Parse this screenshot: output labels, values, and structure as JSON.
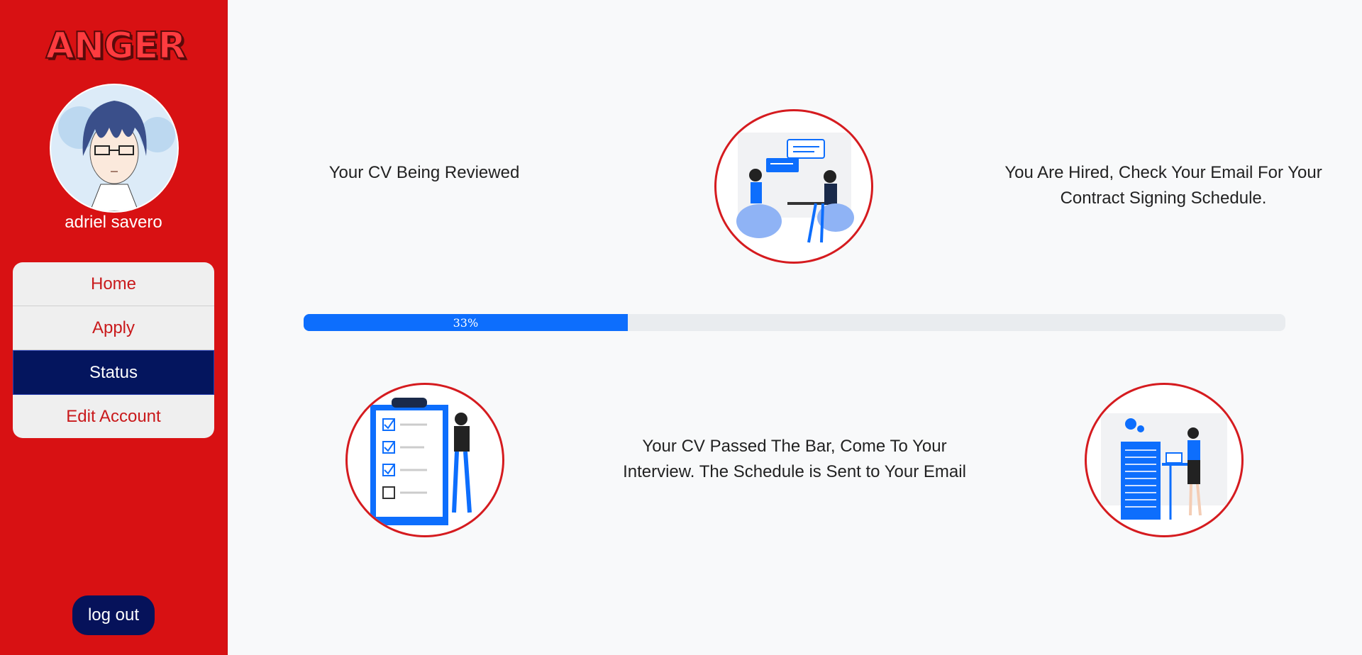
{
  "sidebar": {
    "logo_text": "ANGER",
    "username": "adriel savero",
    "menu": [
      {
        "label": "Home",
        "active": false
      },
      {
        "label": "Apply",
        "active": false
      },
      {
        "label": "Status",
        "active": true
      },
      {
        "label": "Edit Account",
        "active": false
      }
    ],
    "logout_label": "log out"
  },
  "status": {
    "step_reviewed": "Your CV Being Reviewed",
    "step_hired": "You Are Hired, Check Your Email For Your Contract Signing Schedule.",
    "step_interview": "Your CV Passed The Bar, Come To Your Interview. The Schedule is Sent to Your Email",
    "progress_label": "33%",
    "progress_value": 33
  },
  "colors": {
    "sidebar": "#d81113",
    "accent_navy": "#04155e",
    "progress": "#0d6efd",
    "circle_border": "#d51b1f"
  }
}
